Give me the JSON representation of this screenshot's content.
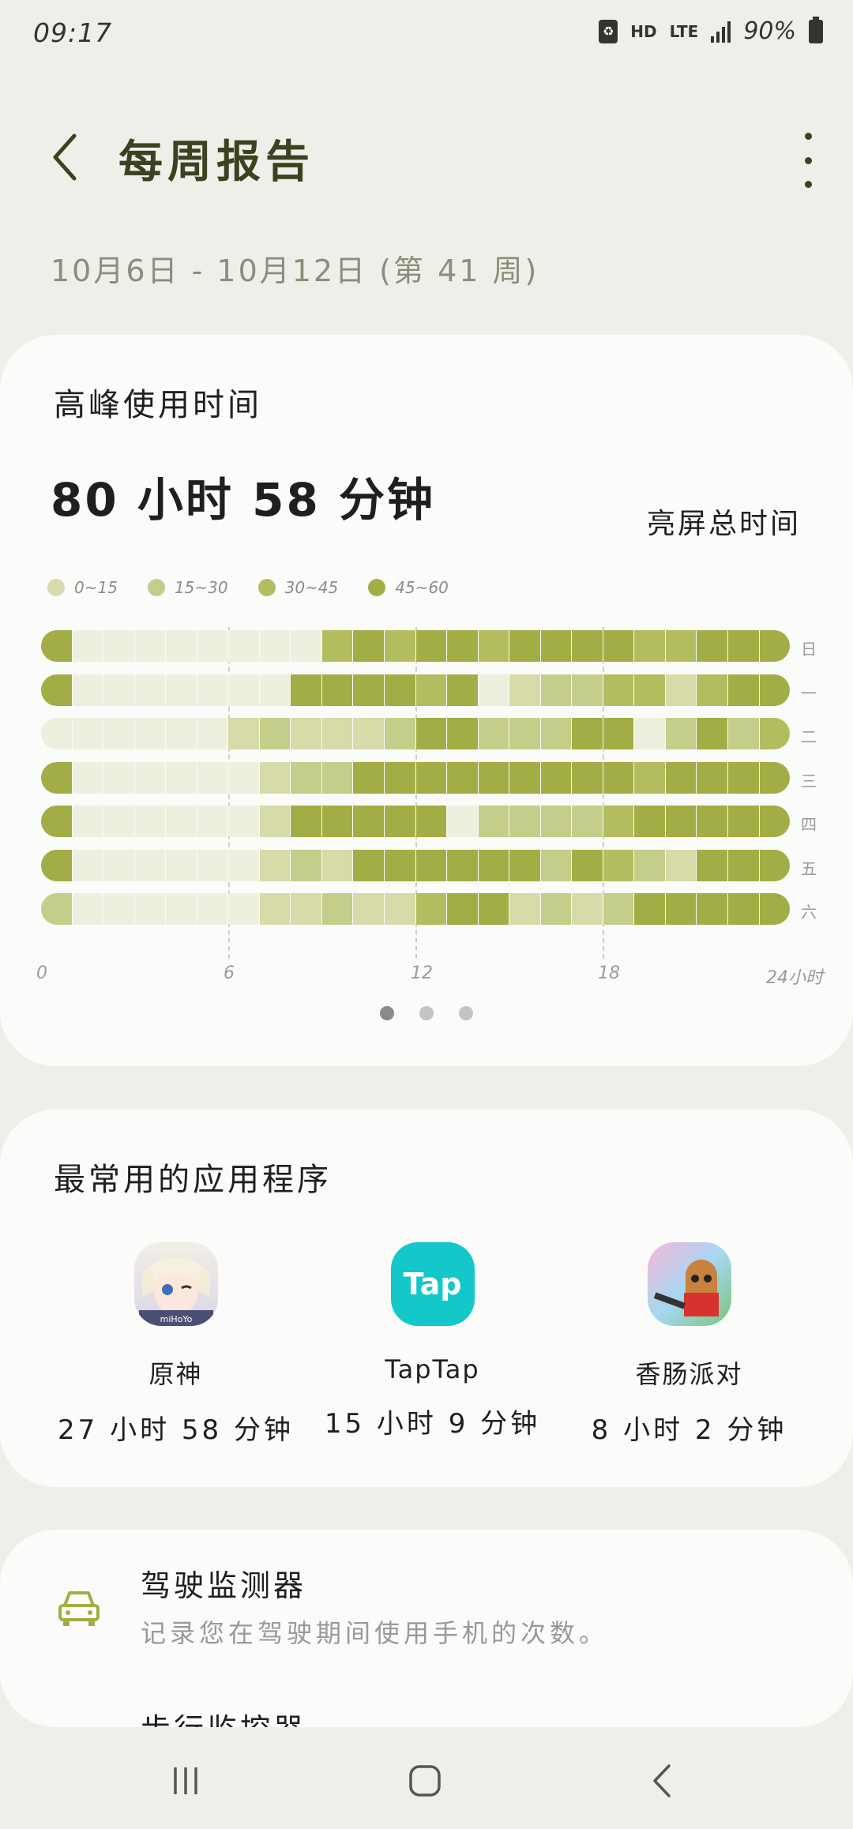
{
  "status_bar": {
    "time": "09:17",
    "hd": "HD",
    "lte": "LTE",
    "battery": "90%"
  },
  "header": {
    "title": "每周报告",
    "back_icon": "chevron-left-icon",
    "more_icon": "more-vertical-icon"
  },
  "date_range": "10月6日 - 10月12日 (第 41 周)",
  "peak_card": {
    "title": "高峰使用时间",
    "total": "80 小时 58 分钟",
    "total_label": "亮屏总时间",
    "legend": [
      {
        "label": "0~15",
        "color": "#d6dba9"
      },
      {
        "label": "15~30",
        "color": "#c5cd8a"
      },
      {
        "label": "30~45",
        "color": "#b3bd5f"
      },
      {
        "label": "45~60",
        "color": "#a3ad45"
      }
    ],
    "pager": {
      "count": 3,
      "active": 0
    }
  },
  "chart_data": {
    "type": "heatmap",
    "x_labels": [
      "0",
      "6",
      "12",
      "18",
      "24小时"
    ],
    "y_labels": [
      "日",
      "一",
      "二",
      "三",
      "四",
      "五",
      "六"
    ],
    "x_unit": "hour",
    "value_unit": "minutes per hour",
    "levels": [
      "none",
      "0~15",
      "15~30",
      "30~45",
      "45~60"
    ],
    "rows": [
      [
        4,
        0,
        0,
        0,
        0,
        0,
        0,
        0,
        0,
        3,
        4,
        3,
        4,
        4,
        3,
        4,
        4,
        4,
        4,
        3,
        3,
        4,
        4,
        4
      ],
      [
        4,
        0,
        0,
        0,
        0,
        0,
        0,
        0,
        4,
        4,
        4,
        4,
        3,
        4,
        0,
        1,
        2,
        2,
        3,
        3,
        1,
        3,
        4,
        4
      ],
      [
        0,
        0,
        0,
        0,
        0,
        0,
        1,
        2,
        1,
        1,
        1,
        2,
        4,
        4,
        2,
        2,
        2,
        4,
        4,
        0,
        2,
        4,
        2,
        3
      ],
      [
        4,
        0,
        0,
        0,
        0,
        0,
        0,
        1,
        2,
        2,
        4,
        4,
        4,
        4,
        4,
        4,
        4,
        4,
        4,
        3,
        4,
        4,
        4,
        4
      ],
      [
        4,
        0,
        0,
        0,
        0,
        0,
        0,
        1,
        4,
        4,
        4,
        4,
        4,
        0,
        2,
        2,
        2,
        2,
        3,
        4,
        4,
        4,
        4,
        4
      ],
      [
        4,
        0,
        0,
        0,
        0,
        0,
        0,
        1,
        2,
        1,
        4,
        4,
        4,
        4,
        4,
        4,
        2,
        4,
        3,
        2,
        1,
        4,
        4,
        4
      ],
      [
        2,
        0,
        0,
        0,
        0,
        0,
        0,
        1,
        1,
        2,
        1,
        1,
        3,
        4,
        4,
        1,
        2,
        1,
        2,
        4,
        4,
        4,
        4,
        4
      ]
    ]
  },
  "top_apps": {
    "title": "最常用的应用程序",
    "apps": [
      {
        "name": "原神",
        "time": "27 小时 58 分钟",
        "icon": "genshin-app-icon"
      },
      {
        "name": "TapTap",
        "time": "15 小时 9 分钟",
        "icon": "taptap-app-icon",
        "icon_text": "Tap"
      },
      {
        "name": "香肠派对",
        "time": "8 小时 2 分钟",
        "icon": "sausage-party-app-icon"
      }
    ]
  },
  "driving_card": {
    "title": "驾驶监测器",
    "subtitle": "记录您在驾驶期间使用手机的次数。",
    "next_title": "步行监控器",
    "icon": "car-icon"
  },
  "nav": {
    "recents_icon": "recents-icon",
    "home_icon": "home-icon",
    "back_icon": "back-icon"
  }
}
